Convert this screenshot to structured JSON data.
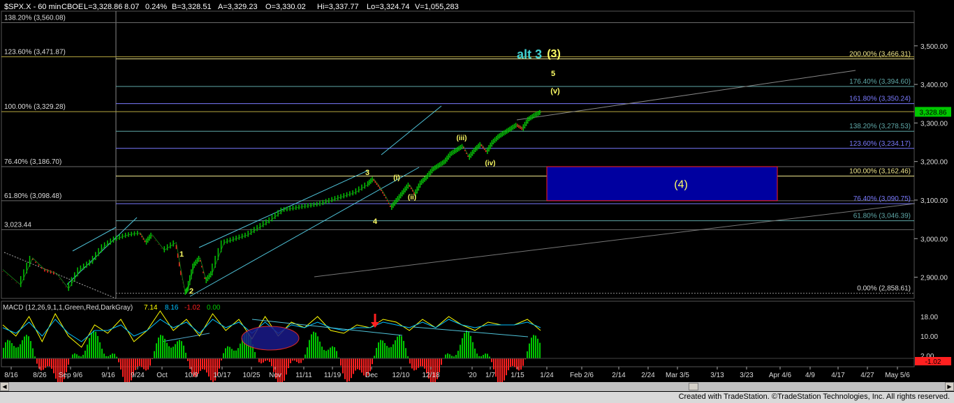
{
  "header": {
    "symbol": "$SPX.X - 60 min",
    "exchange": "CBOE",
    "last": "L=3,328.86",
    "change": "8.07",
    "change_pct": "0.24%",
    "bid": "B=3,328.51",
    "ask": "A=3,329.23",
    "open": "O=3,330.02",
    "high": "Hi=3,337.77",
    "low": "Lo=3,324.74",
    "volume": "V=1,055,283"
  },
  "colors": {
    "price_up": "#00c800",
    "price_down": "#ff2020",
    "fib_yellow": "#f0e68c",
    "fib_blue": "#7b7bff",
    "fib_teal": "#5fa8a8",
    "channel": "#4fc3d9",
    "label_yellow": "#ffff66",
    "alt_label": "#40d0d0",
    "box_fill": "#0000a0",
    "box_border": "#ff2020",
    "macd_line": "#ffff00",
    "signal_line": "#00c0ff",
    "hist_pos": "#00c800",
    "hist_neg": "#ff2020",
    "last_price_bg": "#00c800"
  },
  "chart_data": [
    {
      "type": "line",
      "title": "$SPX.X - 60 min",
      "y_axis_labels": [
        "3,500.00",
        "3,400.00",
        "3,300.00",
        "3,200.00",
        "3,100.00",
        "3,000.00",
        "2,900.00"
      ],
      "ylim": [
        2845,
        3590
      ],
      "last_price": "3,328.86",
      "x_ticks": [
        "8/16",
        "8/26",
        "Sep 9/6",
        "9/16",
        "9/24",
        "Oct",
        "10/9",
        "10/17",
        "10/25",
        "Nov",
        "11/11",
        "11/19",
        "Dec",
        "12/10",
        "12/18",
        "'20",
        "1/7",
        "1/15",
        "1/24",
        "Feb 2/6",
        "2/14",
        "2/24",
        "Mar 3/5",
        "3/13",
        "3/23",
        "Apr 4/6",
        "4/9",
        "4/17",
        "4/27",
        "May 5/6"
      ],
      "price_path": [
        [
          0,
          2920
        ],
        [
          6,
          2880
        ],
        [
          10,
          2950
        ],
        [
          14,
          2920
        ],
        [
          18,
          2910
        ],
        [
          22,
          2870
        ],
        [
          26,
          2920
        ],
        [
          30,
          2940
        ],
        [
          34,
          2980
        ],
        [
          38,
          3000
        ],
        [
          42,
          3010
        ],
        [
          46,
          3015
        ],
        [
          48,
          2990
        ],
        [
          50,
          3010
        ],
        [
          54,
          2970
        ],
        [
          58,
          2990
        ],
        [
          60,
          2900
        ],
        [
          61,
          2860
        ],
        [
          62,
          2870
        ],
        [
          64,
          2930
        ],
        [
          66,
          2950
        ],
        [
          68,
          2890
        ],
        [
          70,
          2910
        ],
        [
          74,
          2990
        ],
        [
          78,
          3000
        ],
        [
          82,
          3010
        ],
        [
          86,
          3030
        ],
        [
          90,
          3050
        ],
        [
          94,
          3075
        ],
        [
          98,
          3080
        ],
        [
          102,
          3085
        ],
        [
          106,
          3090
        ],
        [
          110,
          3100
        ],
        [
          114,
          3110
        ],
        [
          118,
          3120
        ],
        [
          122,
          3140
        ],
        [
          124,
          3155
        ],
        [
          126,
          3135
        ],
        [
          128,
          3110
        ],
        [
          130,
          3080
        ],
        [
          132,
          3100
        ],
        [
          134,
          3120
        ],
        [
          136,
          3140
        ],
        [
          138,
          3115
        ],
        [
          140,
          3145
        ],
        [
          142,
          3160
        ],
        [
          144,
          3180
        ],
        [
          146,
          3190
        ],
        [
          148,
          3200
        ],
        [
          150,
          3220
        ],
        [
          152,
          3230
        ],
        [
          154,
          3240
        ],
        [
          156,
          3210
        ],
        [
          158,
          3230
        ],
        [
          160,
          3245
        ],
        [
          162,
          3225
        ],
        [
          164,
          3250
        ],
        [
          166,
          3265
        ],
        [
          168,
          3275
        ],
        [
          170,
          3285
        ],
        [
          172,
          3295
        ],
        [
          174,
          3285
        ],
        [
          176,
          3310
        ],
        [
          178,
          3320
        ],
        [
          180,
          3328
        ]
      ],
      "fib_levels_left": [
        {
          "label": "138.20% (3,560.08)",
          "value": 3560.08
        },
        {
          "label": "123.60% (3,471.87)",
          "value": 3471.87
        },
        {
          "label": "100.00% (3,329.28)",
          "value": 3329.28
        },
        {
          "label": "76.40% (3,186.70)",
          "value": 3186.7
        },
        {
          "label": "61.80% (3,098.48)",
          "value": 3098.48
        },
        {
          "label": "3,023.44",
          "value": 3023.44
        }
      ],
      "fib_levels_right": [
        {
          "label": "200.00% (3,466.31)",
          "value": 3466.31
        },
        {
          "label": "176.40% (3,394.60)",
          "value": 3394.6
        },
        {
          "label": "161.80% (3,350.24)",
          "value": 3350.24
        },
        {
          "label": "138.20% (3,278.53)",
          "value": 3278.53
        },
        {
          "label": "123.60% (3,234.17)",
          "value": 3234.17
        },
        {
          "label": "100.00% (3,162.46)",
          "value": 3162.46
        },
        {
          "label": "76.40% (3,090.75)",
          "value": 3090.75
        },
        {
          "label": "61.80% (3,046.39)",
          "value": 3046.39
        },
        {
          "label": "0.00% (2,858.61)",
          "value": 2858.61
        }
      ],
      "wave_labels": [
        {
          "text": "alt 3",
          "color": "alt"
        },
        {
          "text": "(3)",
          "color": "yellow"
        },
        {
          "text": "5",
          "color": "yellow"
        },
        {
          "text": "(v)",
          "color": "yellow"
        },
        {
          "text": "(iii)",
          "color": "yellow"
        },
        {
          "text": "(iv)",
          "color": "yellow"
        },
        {
          "text": "3",
          "color": "yellow"
        },
        {
          "text": "(i)",
          "color": "yellow"
        },
        {
          "text": "(ii)",
          "color": "yellow"
        },
        {
          "text": "4",
          "color": "yellow"
        },
        {
          "text": "1",
          "color": "yellow"
        },
        {
          "text": "2",
          "color": "yellow"
        },
        {
          "text": "(4)",
          "color": "yellow"
        }
      ],
      "target_box": {
        "label": "(4)",
        "from": 3098.48,
        "to": 3186.7
      }
    },
    {
      "type": "line",
      "title": "MACD (12,26,9,1,1,Green,Red,DarkGray)",
      "values": [
        "7.14",
        "8.16",
        "-1.02",
        "0.00"
      ],
      "y_axis_labels": [
        "18.00",
        "10.00",
        "2.00"
      ],
      "last_label": "-1.02",
      "series": [
        {
          "name": "MACD",
          "values": [
            12,
            8,
            15,
            6,
            16,
            8,
            4,
            12,
            9,
            14,
            6,
            10,
            17,
            10,
            14,
            8,
            16,
            10,
            14,
            7,
            15,
            8,
            13,
            11,
            15,
            10,
            9,
            12,
            11,
            14,
            13,
            10,
            14,
            11,
            15,
            12,
            10,
            13,
            12,
            12,
            14,
            10
          ]
        },
        {
          "name": "Signal",
          "values": [
            11,
            9,
            13,
            8,
            14,
            9,
            6,
            10,
            10,
            12,
            8,
            10,
            14,
            11,
            13,
            9,
            14,
            11,
            13,
            9,
            13,
            9,
            12,
            11,
            13,
            11,
            10,
            11,
            11,
            13,
            12,
            11,
            13,
            11,
            14,
            12,
            11,
            12,
            12,
            12,
            13,
            11
          ]
        }
      ]
    }
  ],
  "footer": {
    "credit": "Created with TradeStation. ©TradeStation Technologies, Inc. All rights reserved."
  },
  "scrollbar": {
    "left_icon": "arrow-left-icon",
    "right_icon": "arrow-right-icon"
  }
}
